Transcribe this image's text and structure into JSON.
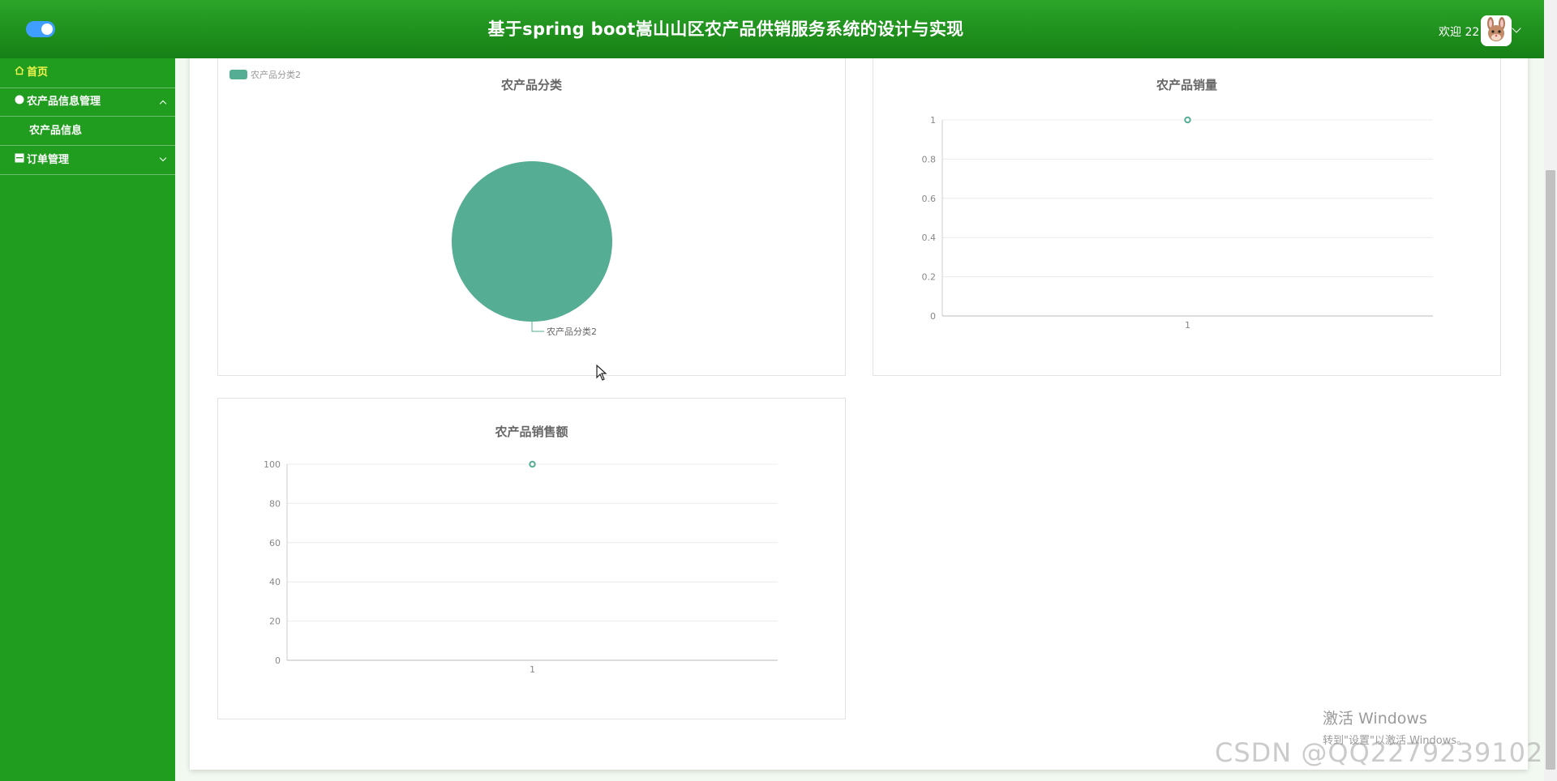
{
  "header": {
    "title": "基于spring boot嵩山山区农产品供销服务系统的设计与实现",
    "welcome": "欢迎 22"
  },
  "sidebar": {
    "items": [
      {
        "label": "首页",
        "icon": "home-icon",
        "active": true
      },
      {
        "label": "农产品信息管理",
        "icon": "circle-icon",
        "expanded": true
      },
      {
        "label": "农产品信息",
        "sub": true
      },
      {
        "label": "订单管理",
        "icon": "archive-icon",
        "expanded": false
      }
    ]
  },
  "colors": {
    "header": "#1e8e1c",
    "sidebar": "#209d1f",
    "active_menu": "#f1f54e",
    "series": "#55ad94"
  },
  "chart_data": [
    {
      "type": "pie",
      "title": "农产品分类",
      "legend": [
        "农产品分类2"
      ],
      "legend_position": "top-left",
      "slices": [
        {
          "name": "农产品分类2",
          "value": 1
        }
      ]
    },
    {
      "type": "line",
      "title": "农产品销量",
      "categories": [
        "1"
      ],
      "values": [
        1
      ],
      "ylim": [
        0,
        1
      ],
      "yticks": [
        "0",
        "0.2",
        "0.4",
        "0.6",
        "0.8",
        "1"
      ],
      "grid": true
    },
    {
      "type": "line",
      "title": "农产品销售额",
      "categories": [
        "1"
      ],
      "values": [
        100
      ],
      "ylim": [
        0,
        100
      ],
      "yticks": [
        "0",
        "20",
        "40",
        "60",
        "80",
        "100"
      ],
      "grid": true
    }
  ],
  "watermark": {
    "activate_title": "激活 Windows",
    "activate_sub": "转到\"设置\"以激活 Windows。",
    "csdn": "CSDN @QQ2279239102"
  }
}
